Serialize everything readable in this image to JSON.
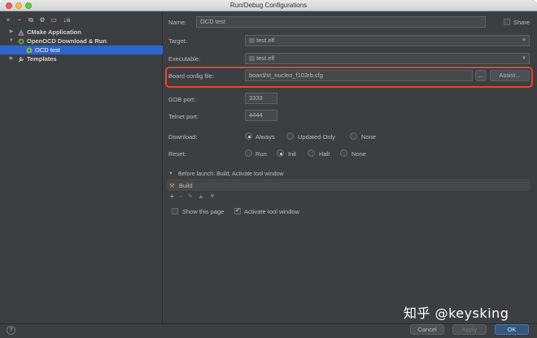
{
  "window": {
    "title": "Run/Debug Configurations"
  },
  "toolbar": {
    "add": "+",
    "remove": "−",
    "copy": "⧉",
    "edit": "⚙",
    "folder": "▭",
    "sort": "↓a"
  },
  "tree": {
    "items": [
      {
        "label": "CMake Application"
      },
      {
        "label": "OpenOCD Download & Run"
      },
      {
        "label": "OCD test"
      },
      {
        "label": "Templates"
      }
    ]
  },
  "form": {
    "name_label": "Name:",
    "name_value": "OCD test",
    "share_label": "Share",
    "target_label": "Target:",
    "target_value": "test.elf",
    "executable_label": "Executable:",
    "executable_value": "test.elf",
    "board_label": "Board config file:",
    "board_value": "board/st_nucleo_f103rb.cfg",
    "browse_label": "...",
    "assist_label": "Assist...",
    "gdb_label": "GDB port:",
    "gdb_value": "3333",
    "telnet_label": "Telnet port:",
    "telnet_value": "4444",
    "download_label": "Download:",
    "download_options": [
      "Always",
      "Updated Only",
      "None"
    ],
    "reset_label": "Reset:",
    "reset_options": [
      "Run",
      "Init",
      "Halt",
      "None"
    ]
  },
  "before_launch": {
    "header": "Before launch: Build, Activate tool window",
    "task": "Build",
    "show_page_label": "Show this page",
    "activate_label": "Activate tool window"
  },
  "footer": {
    "help": "?",
    "cancel": "Cancel",
    "apply": "Apply",
    "ok": "OK"
  },
  "watermark": "知乎 @keysking",
  "colors": {
    "selection": "#2f65ca",
    "highlight": "#e8442f",
    "background": "#3c3f41"
  }
}
